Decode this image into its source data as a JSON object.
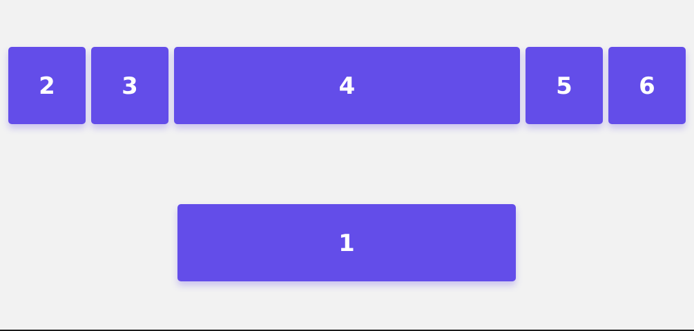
{
  "tiles": {
    "top_row": [
      {
        "label": "2"
      },
      {
        "label": "3"
      },
      {
        "label": "4"
      },
      {
        "label": "5"
      },
      {
        "label": "6"
      }
    ],
    "bottom": {
      "label": "1"
    }
  },
  "colors": {
    "background": "#f2f2f2",
    "tile": "#634de9",
    "text": "#ffffff",
    "bottom_line": "#1c1c1c"
  }
}
